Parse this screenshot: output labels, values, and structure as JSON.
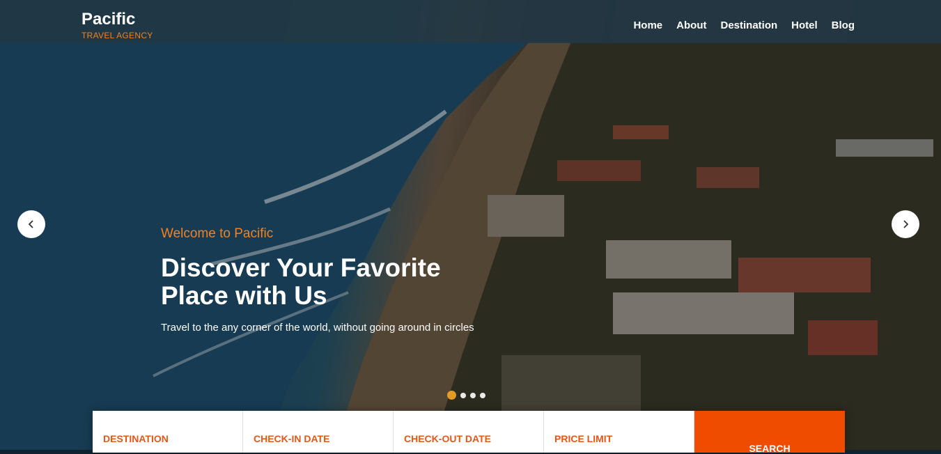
{
  "brand": {
    "name": "Pacific",
    "tagline": "TRAVEL AGENCY"
  },
  "nav": {
    "items": [
      "Home",
      "About",
      "Destination",
      "Hotel",
      "Blog"
    ]
  },
  "hero": {
    "welcome": "Welcome to Pacific",
    "headline": "Discover Your Favorite Place with Us",
    "subtext": "Travel to the any corner of the world, without going around in circles"
  },
  "carousel": {
    "slide_count": 4,
    "active_index": 0,
    "prev_icon": "chevron-left-icon",
    "next_icon": "chevron-right-icon"
  },
  "search": {
    "fields": [
      "DESTINATION",
      "CHECK-IN DATE",
      "CHECK-OUT DATE",
      "PRICE LIMIT"
    ],
    "button_label": "SEARCH"
  },
  "colors": {
    "accent": "#f5821f",
    "search_button": "#ef4c00",
    "active_dot": "#f5a623"
  }
}
